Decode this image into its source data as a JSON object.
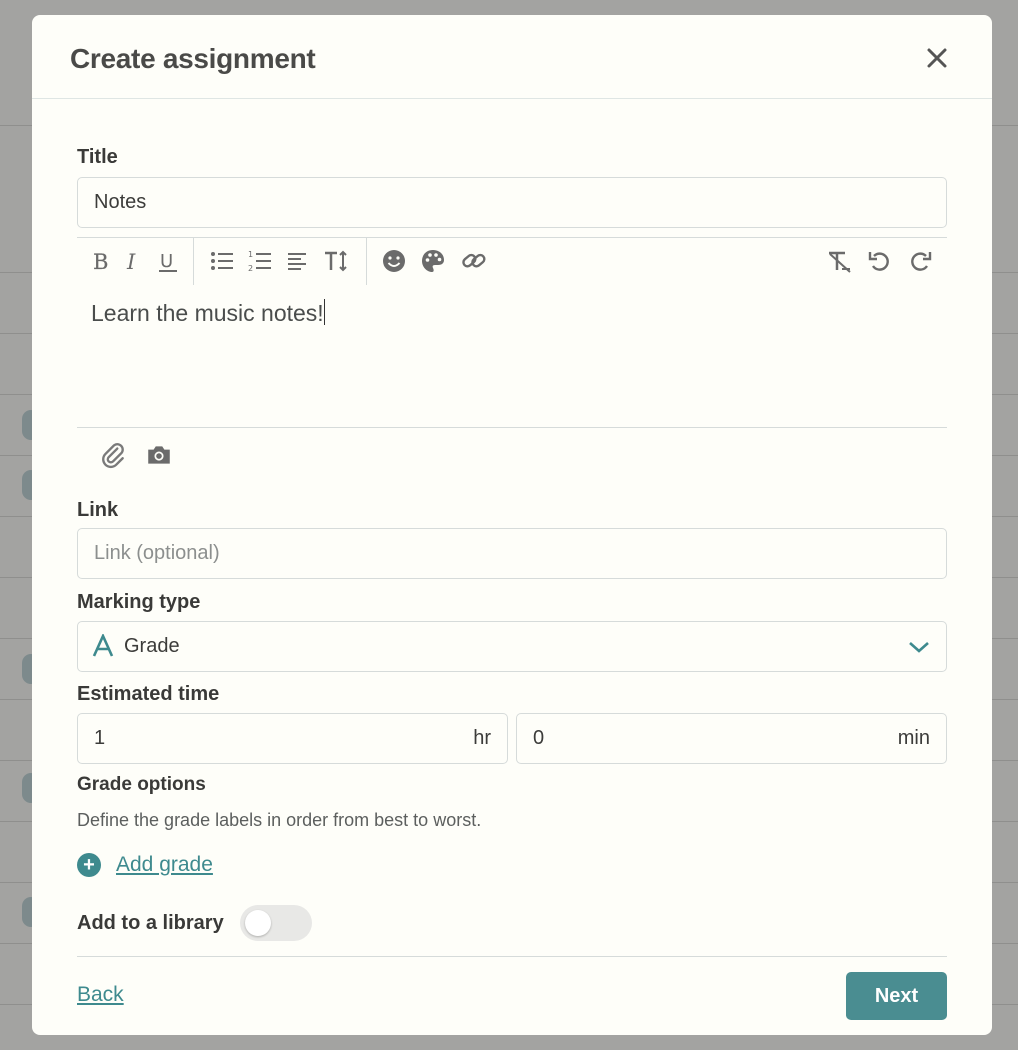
{
  "modal": {
    "title": "Create assignment",
    "close_icon": "close-icon"
  },
  "form": {
    "title_label": "Title",
    "title_value": "Notes",
    "editor": {
      "toolbar_icons": [
        "bold-icon",
        "italic-icon",
        "underline-icon",
        "bullet-list-icon",
        "numbered-list-icon",
        "align-icon",
        "text-size-icon",
        "emoji-icon",
        "palette-icon",
        "link-icon",
        "clear-format-icon",
        "undo-icon",
        "redo-icon"
      ],
      "content": "Learn the music notes!",
      "attachment_icons": [
        "paperclip-icon",
        "camera-icon"
      ]
    },
    "link_label": "Link",
    "link_placeholder": "Link (optional)",
    "marking_type_label": "Marking type",
    "marking_type_value": "Grade",
    "estimated_time_label": "Estimated time",
    "hours_value": "1",
    "hours_unit": "hr",
    "minutes_value": "0",
    "minutes_unit": "min",
    "grade_options_label": "Grade options",
    "grade_options_help": "Define the grade labels in order from best to worst.",
    "add_grade_label": "Add grade",
    "add_to_library_label": "Add to a library",
    "add_to_library_on": false
  },
  "footer": {
    "back_label": "Back",
    "next_label": "Next"
  },
  "colors": {
    "accent": "#3e8a8e",
    "primary_button": "#4a8d91",
    "modal_bg": "#fefef9",
    "border": "#d6dbda"
  }
}
